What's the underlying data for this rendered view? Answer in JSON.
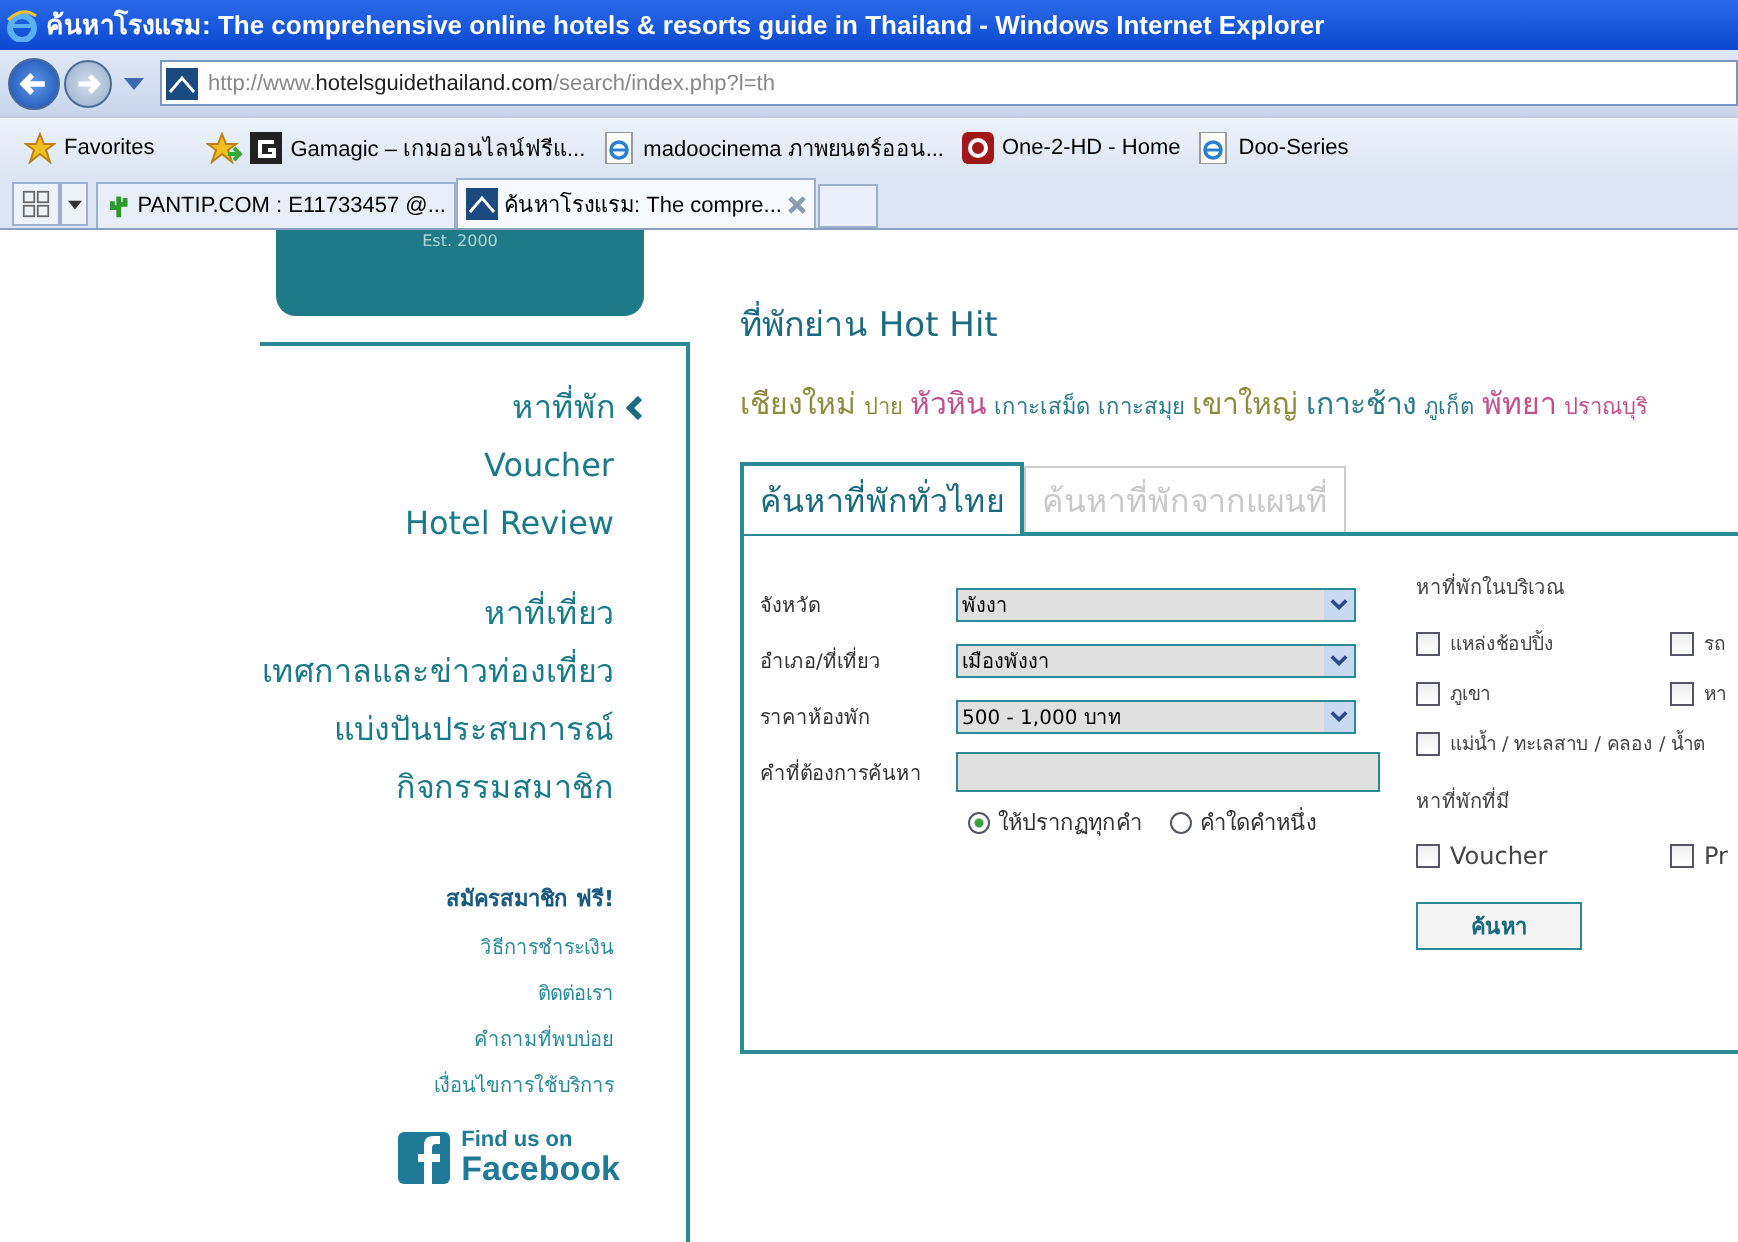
{
  "window": {
    "title": "ค้นหาโรงแรม: The comprehensive online hotels & resorts guide in Thailand - Windows Internet Explorer"
  },
  "address_bar": {
    "url_prefix": "http://www.",
    "url_domain": "hotelsguidethailand.com",
    "url_path": "/search/index.php?l=th"
  },
  "favorites_bar": {
    "label": "Favorites",
    "items": [
      {
        "kind": "gamagic",
        "label": "Gamagic – เกมออนไลน์ฟรีแ..."
      },
      {
        "kind": "ie",
        "label": "madoocinema ภาพยนตร์ออน..."
      },
      {
        "kind": "red",
        "label": "One-2-HD - Home"
      },
      {
        "kind": "ie",
        "label": "Doo-Series"
      }
    ]
  },
  "browser_tabs": [
    {
      "kind": "cactus",
      "label": "PANTIP.COM : E11733457 @...",
      "selected": false
    },
    {
      "kind": "site",
      "label": "ค้นหาโรงแรม: The compre...",
      "selected": true
    }
  ],
  "logo": {
    "text": "Est. 2000"
  },
  "sidebar": {
    "items": [
      {
        "label": "หาที่พัก",
        "selected": true
      },
      {
        "label": "Voucher",
        "selected": false
      },
      {
        "label": "Hotel Review",
        "selected": false
      }
    ],
    "items2": [
      {
        "label": "หาที่เที่ยว"
      },
      {
        "label": "เทศกาลและข่าวท่องเที่ยว"
      },
      {
        "label": "แบ่งปันประสบการณ์"
      },
      {
        "label": "กิจกรรมสมาชิก"
      }
    ],
    "signup": "สมัครสมาชิก ฟรี!",
    "links": [
      "วิธีการชำระเงิน",
      "ติดต่อเรา",
      "คำถามที่พบบ่อย",
      "เงื่อนไขการใช้บริการ"
    ],
    "facebook": {
      "line1": "Find us on",
      "line2": "Facebook"
    }
  },
  "hot_hit": {
    "title": "ที่พักย่าน Hot Hit",
    "places": [
      {
        "label": "เชียงใหม่",
        "kind": "big",
        "color": "#8c8c3c"
      },
      {
        "label": "ปาย",
        "kind": "small",
        "color": "#8c8c3c"
      },
      {
        "label": "หัวหิน",
        "kind": "big",
        "color": "#c0508c"
      },
      {
        "label": "เกาะเสม็ด",
        "kind": "small",
        "color": "#2a7a8a"
      },
      {
        "label": "เกาะสมุย",
        "kind": "small",
        "color": "#2a7a8a"
      },
      {
        "label": "เขาใหญ่",
        "kind": "big",
        "color": "#8c8c3c"
      },
      {
        "label": "เกาะช้าง",
        "kind": "big",
        "color": "#2a7a8a"
      },
      {
        "label": "ภูเก็ต",
        "kind": "small",
        "color": "#2a7a8a"
      },
      {
        "label": "พัทยา",
        "kind": "big",
        "color": "#c0508c"
      },
      {
        "label": "ปราณบุริ",
        "kind": "small",
        "color": "#c0508c"
      }
    ]
  },
  "search_tabs": [
    {
      "label": "ค้นหาที่พักทั่วไทย",
      "selected": true
    },
    {
      "label": "ค้นหาที่พักจากแผนที่",
      "selected": false
    }
  ],
  "form": {
    "fields": [
      {
        "kind": "select",
        "label": "จังหวัด",
        "value": "พังงา"
      },
      {
        "kind": "select",
        "label": "อำเภอ/ที่เที่ยว",
        "value": "เมืองพังงา"
      },
      {
        "kind": "select",
        "label": "ราคาห้องพัก",
        "value": "500 - 1,000 บาท"
      },
      {
        "kind": "text",
        "label": "คำที่ต้องการค้นหา"
      }
    ],
    "match_options": [
      {
        "label": "ให้ปรากฏทุกคำ",
        "selected": true
      },
      {
        "label": "คำใดคำหนึ่ง",
        "selected": false
      }
    ],
    "nearby_title": "หาที่พักในบริเวณ",
    "nearby": [
      {
        "label": "แหล่งช้อปปิ้ง",
        "checked": false
      },
      {
        "label": "รถ",
        "checked": false
      },
      {
        "label": "ภูเขา",
        "checked": false
      },
      {
        "label": "หา",
        "checked": false
      },
      {
        "label": "แม่น้ำ / ทะเลสาบ / คลอง / น้ำต",
        "checked": false
      }
    ],
    "has_title": "หาที่พักที่มี",
    "has": [
      {
        "label": "Voucher",
        "checked": false
      },
      {
        "label": "Pr",
        "checked": false
      }
    ],
    "submit": "ค้นหา"
  }
}
